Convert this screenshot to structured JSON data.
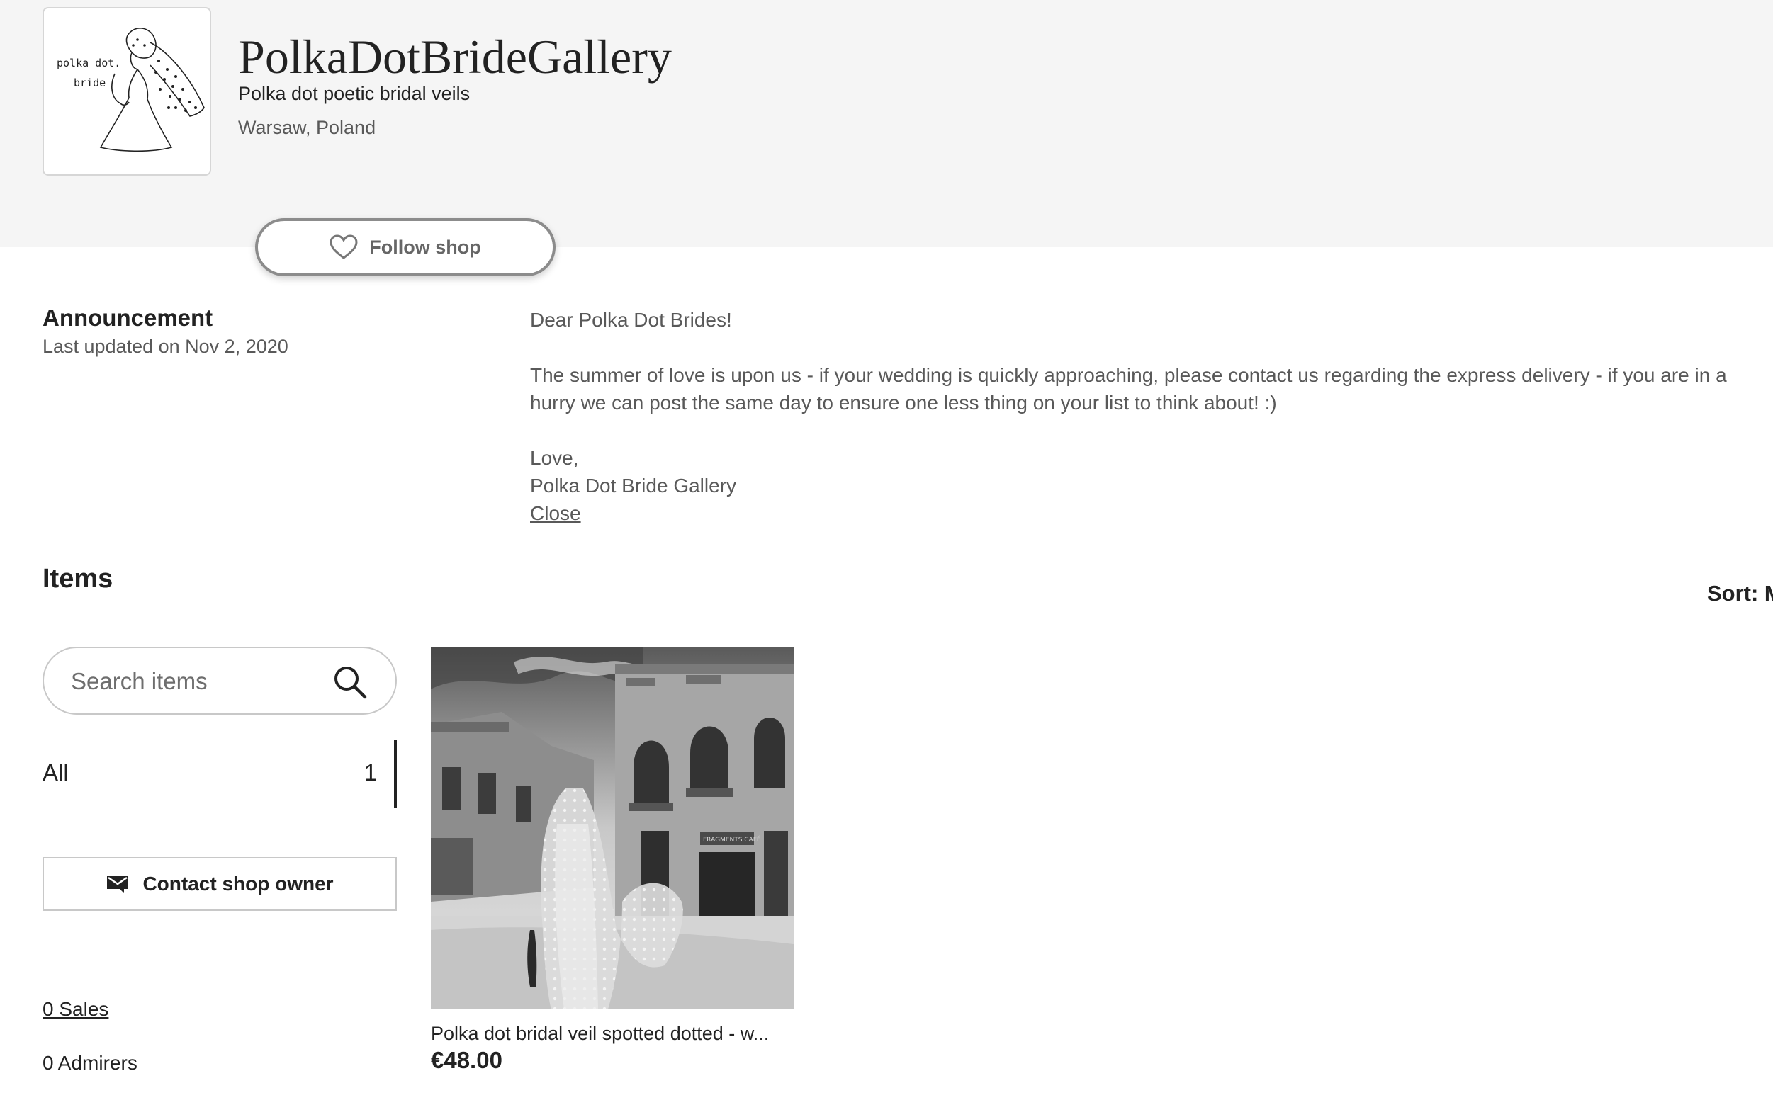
{
  "shop": {
    "logo": {
      "line1": "polka dot.",
      "line2": "bride"
    },
    "name": "PolkaDotBrideGallery",
    "tagline": "Polka dot poetic bridal veils",
    "location": "Warsaw, Poland",
    "follow_label": "Follow shop"
  },
  "announcement": {
    "title": "Announcement",
    "updated": "Last updated on Nov 2, 2020",
    "greeting": "Dear Polka Dot Brides!",
    "message": "The summer of love is upon us - if your wedding is quickly approaching, please contact us regarding the express delivery - if you are in a hurry we can post the same day to ensure one less thing on your list to think about! :)",
    "signoff": "Love,",
    "signature": "Polka Dot Bride Gallery",
    "close_label": "Close"
  },
  "items": {
    "title": "Items",
    "sort_label": "Sort: M",
    "search_placeholder": "Search items",
    "sections": [
      {
        "label": "All",
        "count": "1"
      }
    ],
    "contact_label": "Contact shop owner",
    "sales": "0 Sales",
    "admirers": "0 Admirers"
  },
  "listings": [
    {
      "title": "Polka dot bridal veil spotted dotted - w...",
      "price": "€48.00",
      "storefront_sign": "FRAGMENTS CAFÉ"
    }
  ],
  "icons": {
    "follow": "heart-icon",
    "search": "search-icon",
    "contact": "envelope-icon"
  },
  "colors": {
    "banner_bg": "#f5f5f5",
    "text": "#222222",
    "muted": "#595959",
    "border": "#c8c8c8"
  }
}
